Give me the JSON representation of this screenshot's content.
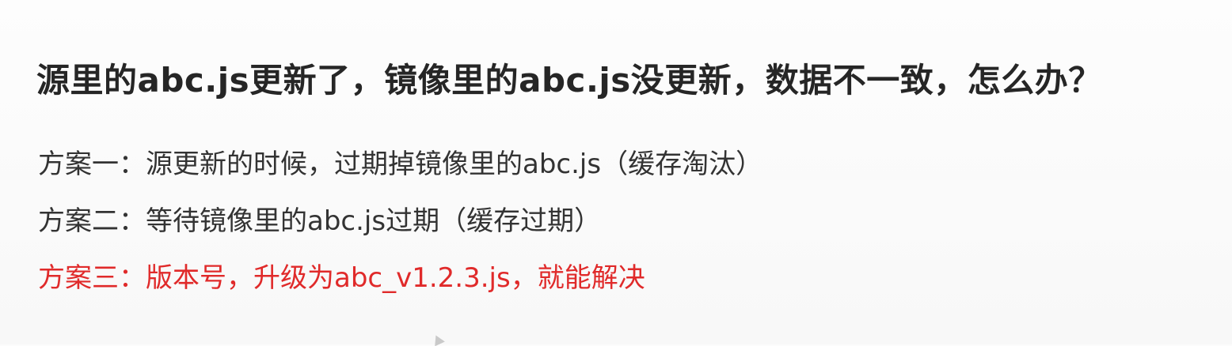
{
  "slide": {
    "title": "源里的abc.js更新了，镜像里的abc.js没更新，数据不一致，怎么办？",
    "options": [
      "方案一：源更新的时候，过期掉镜像里的abc.js（缓存淘汰）",
      "方案二：等待镜像里的abc.js过期（缓存过期）",
      "方案三：版本号，升级为abc_v1.2.3.js，就能解决"
    ]
  },
  "colors": {
    "text": "#333333",
    "highlight": "#e02a2a",
    "background": "#fcfcfc"
  }
}
